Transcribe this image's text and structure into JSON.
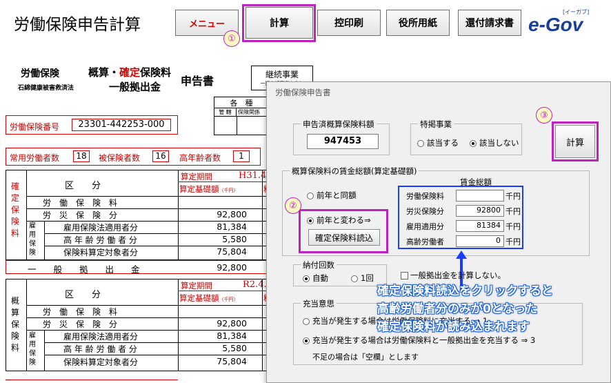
{
  "app": {
    "title": "労働保険申告計算"
  },
  "toolbar": {
    "menu": "メニュー",
    "calc": "計算",
    "print": "控印刷",
    "office_form": "役所用紙",
    "refund": "還付請求書",
    "egov": "e-Gov",
    "egov_sub": "[イーガブ]"
  },
  "form": {
    "header_a": "労働保険",
    "header_b1": "概算・",
    "header_b2": "確定",
    "header_b3": "保険料",
    "header_c": "申告書",
    "header_d": "一般拠出金",
    "header_law": "石綿健康被害救済法",
    "continuing": "継続事業",
    "continuing_sub": "一括有期事業を含む",
    "kakushu": "各　種",
    "kankatsu": "管 轄",
    "hoken": "保険関係",
    "insurance_no_label": "労働保険番号",
    "insurance_no": "23301-442253-000",
    "emp_label": "常用労働者数",
    "emp_count": "18",
    "insured_label": "被保険者数",
    "insured_count": "16",
    "elderly_label": "高年齢者数",
    "elderly_count": "1",
    "section1": {
      "side": [
        "確",
        "定",
        "保",
        "険",
        "料"
      ],
      "kubun": "区　　分",
      "period_label": "算定期間",
      "period": "H31.4.",
      "base_label": "算定基礎額",
      "unit": "（千円）",
      "rate_col": "料",
      "rows": [
        {
          "label": "労　働　保　険　料",
          "value": ""
        },
        {
          "label": "労　災　保　険　分",
          "value": "92,800"
        },
        {
          "label": "雇用保険法適用者分",
          "value": "81,384"
        },
        {
          "label": "高 年 齢 労 働 者 分",
          "value": "5,580"
        },
        {
          "label": "保険料算定対象者分",
          "value": "75,804"
        }
      ],
      "sub_side": [
        "雇",
        "用",
        "保",
        "険"
      ],
      "general_label": "一　　般　　拠　　出　　金",
      "general_value": "92,800"
    },
    "section2": {
      "side": [
        "概",
        "算",
        "保",
        "険",
        "料"
      ],
      "kubun": "区　　分",
      "period_label": "算定期間",
      "period": "R2.4.",
      "base_label": "算定基礎額",
      "unit": "（千円）",
      "rate_col": "料",
      "rows": [
        {
          "label": "労　働　保　険　料",
          "value": ""
        },
        {
          "label": "労　災　保　険　分",
          "value": "92,800"
        },
        {
          "label": "雇用保険法適用者分",
          "value": "81,384"
        },
        {
          "label": "高 年 齢 労 働 者 分",
          "value": "5,580"
        },
        {
          "label": "保険料算定対象者分",
          "value": "75,804"
        }
      ],
      "sub_side": [
        "雇",
        "用",
        "保",
        "険"
      ]
    }
  },
  "dialog": {
    "title": "労働保険申告書",
    "declared_group": "申告済概算保険料額",
    "declared_value": "947453",
    "special_group": "特掲事業",
    "special_yes": "該当する",
    "special_no": "該当しない",
    "calc_button": "計算",
    "wage_group": "概算保険料の賃金総額(算定基礎額)",
    "same_as_prev": "前年と同額",
    "changed": "前年と変わる⇒",
    "load_button": "確定保険料読込",
    "wage_header": "賃金総額",
    "wage_rows": [
      {
        "label": "労働保険料",
        "value": "",
        "unit": "千円"
      },
      {
        "label": "労災保険分",
        "value": "92800",
        "unit": "千円"
      },
      {
        "label": "雇用適用分",
        "value": "81384",
        "unit": "千円"
      },
      {
        "label": "高齢労働者",
        "value": "0",
        "unit": "千円"
      }
    ],
    "installments_group": "納付回数",
    "auto": "自動",
    "once": "1回",
    "no_general": "一般拠出金を計算しない。",
    "allocation_group": "充当意思",
    "alloc_opt1": "充当が発生する場合は労働保険料に充当する ⇒ 1",
    "alloc_opt2": "充当が発生する場合は労働保険料と一般拠出金を充当する ⇒ 3",
    "alloc_note": "不足の場合は「空欄」とします"
  },
  "annotations": {
    "step1": "①",
    "step2": "②",
    "step3": "③",
    "callout_line1": "確定保険料読込をクリックすると",
    "callout_line2": "高齢労働者分のみが0となった",
    "callout_line3": "確定保険料が読み込まれます"
  },
  "colors": {
    "accent_magenta": "#c020c0",
    "form_red": "#d00000",
    "highlight_blue": "#1a3cff"
  }
}
